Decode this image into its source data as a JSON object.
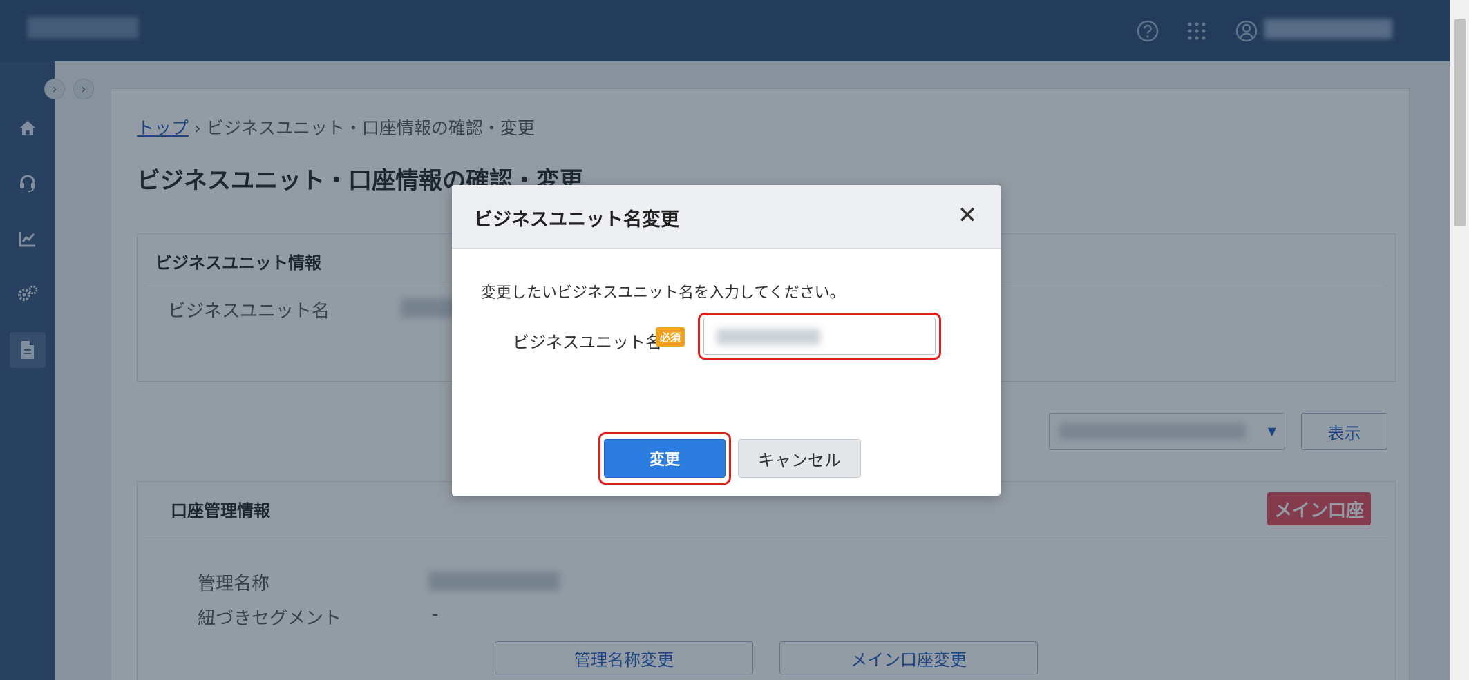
{
  "breadcrumb": {
    "home": "トップ",
    "separator": "›",
    "current": "ビジネスユニット・口座情報の確認・変更"
  },
  "page_title": "ビジネスユニット・口座情報の確認・変更",
  "bu_panel": {
    "title": "ビジネスユニット情報",
    "name_label": "ビジネスユニット名"
  },
  "controls": {
    "show_button": "表示"
  },
  "account_panel": {
    "title": "口座管理情報",
    "main_badge": "メイン口座",
    "mgmt_name_label": "管理名称",
    "segment_label": "紐づきセグメント",
    "segment_value": "-",
    "rename_button": "管理名称変更",
    "main_account_button": "メイン口座変更"
  },
  "modal": {
    "title": "ビジネスユニット名変更",
    "close_label": "✕",
    "description": "変更したいビジネスユニット名を入力してください。",
    "field_label": "ビジネスユニット名",
    "required_badge": "必須",
    "submit_label": "変更",
    "cancel_label": "キャンセル"
  },
  "icons": [
    "help-icon",
    "apps-grid-icon",
    "user-icon",
    "home-icon",
    "support-icon",
    "chart-icon",
    "settings-icon",
    "document-icon",
    "chevron-right-icon",
    "close-icon",
    "caret-down-icon"
  ],
  "colors": {
    "header": "#2b4a73",
    "sidebar": "#33537d",
    "primary": "#2d7de0",
    "danger": "#e5485a",
    "required": "#f2a31b",
    "highlight": "#e0201c"
  }
}
